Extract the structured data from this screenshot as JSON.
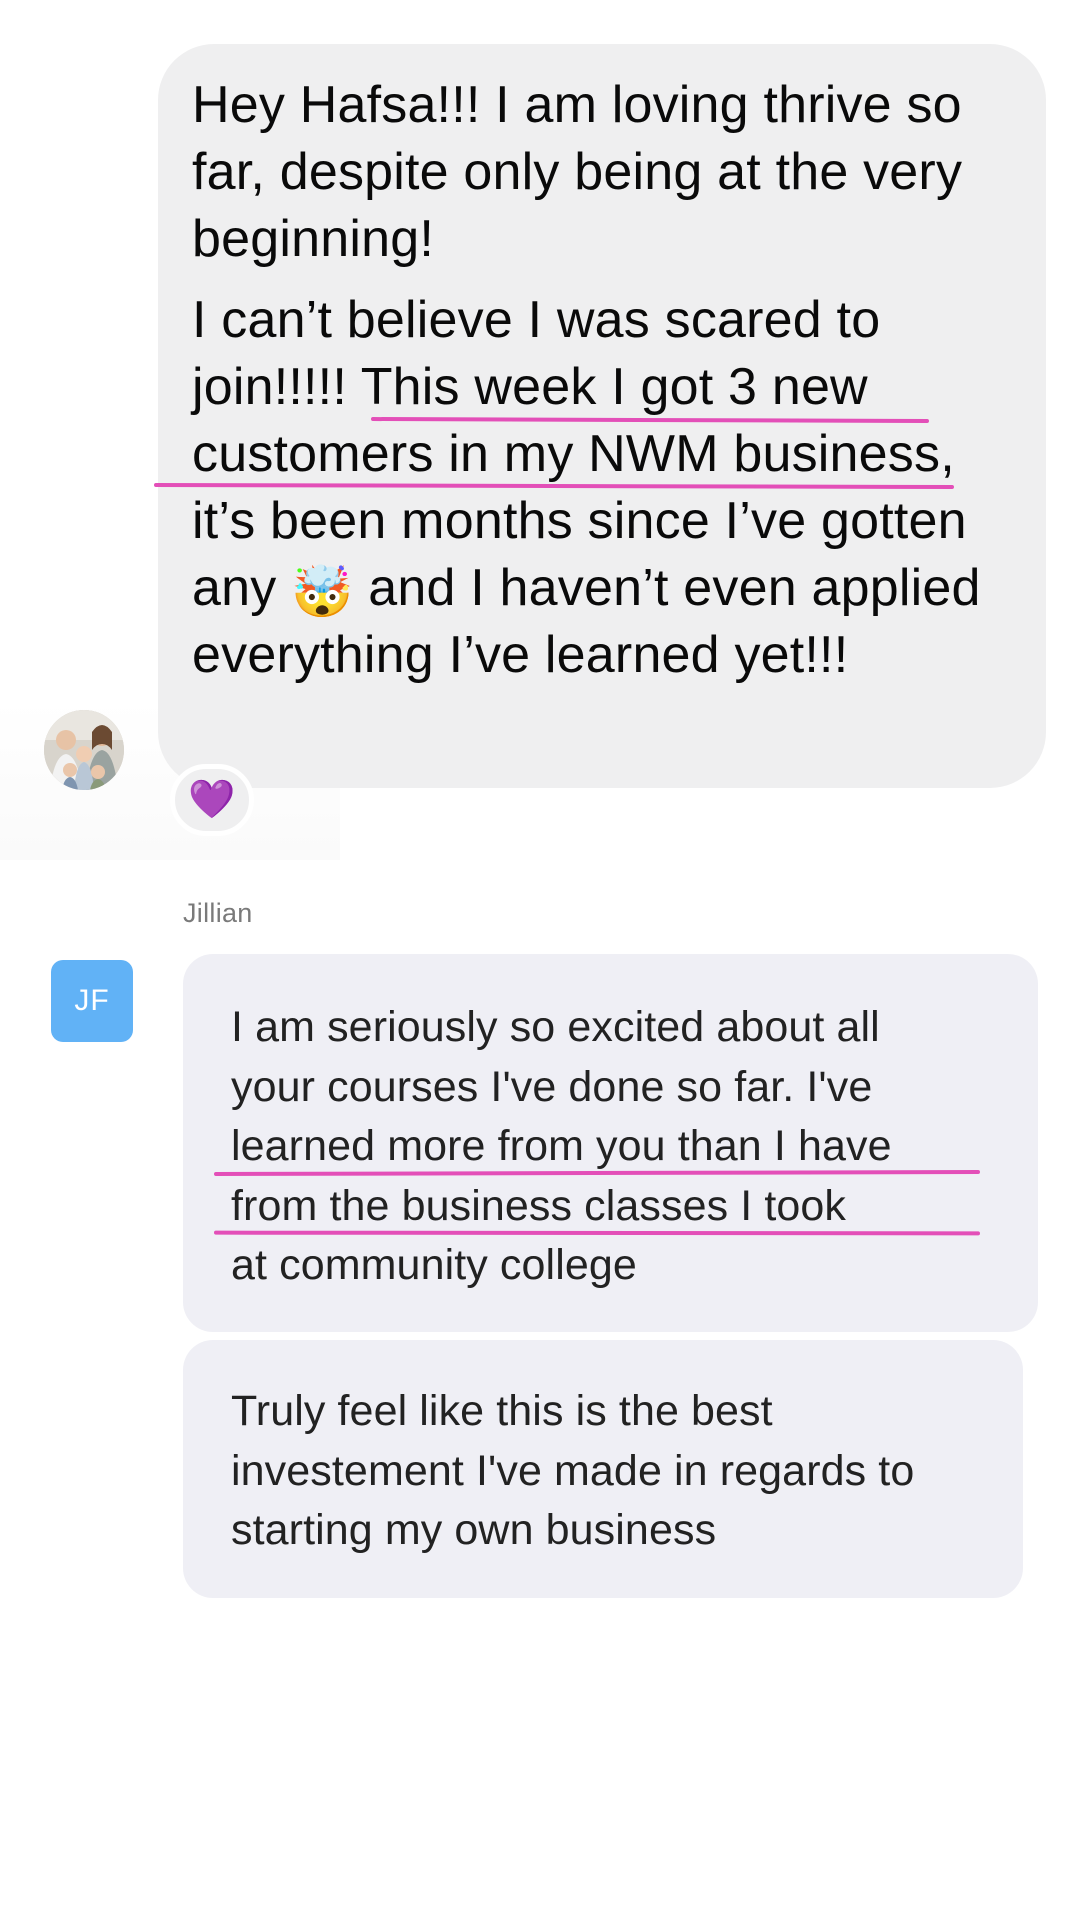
{
  "message_1": {
    "paragraph_1": "Hey Hafsa!!! I am loving thrive so far, despite only being at the very beginning!",
    "p2_line1": "I can’t believe I was scared to",
    "p2_prefix": "join!!!!! ",
    "p2_highlight_a": "This week I got 3 new",
    "p2_highlight_b": "customers in my NWM business",
    "p2_after": ", it’s been months since I’ve gotten any",
    "p2_emoji": "🤯",
    "p2_end": "and I haven’t even applied everything I’ve learned yet!!!"
  },
  "reaction": {
    "emoji": "💜"
  },
  "sender": {
    "name": "Jillian",
    "initials": "JF"
  },
  "message_2": {
    "line_1": "I am seriously so excited about all",
    "line_2": "your courses I've done so far. I've",
    "line_3": "learned more from you than I have",
    "line_4": "from the business classes I took",
    "line_5": "at community college"
  },
  "message_3": {
    "text": "Truly feel like this is the best investement I've made in regards to starting my own business"
  },
  "colors": {
    "highlight_underline": "#e34fb8",
    "incoming_bubble": "#efeff0",
    "avatar_blue": "#61b2f6"
  }
}
